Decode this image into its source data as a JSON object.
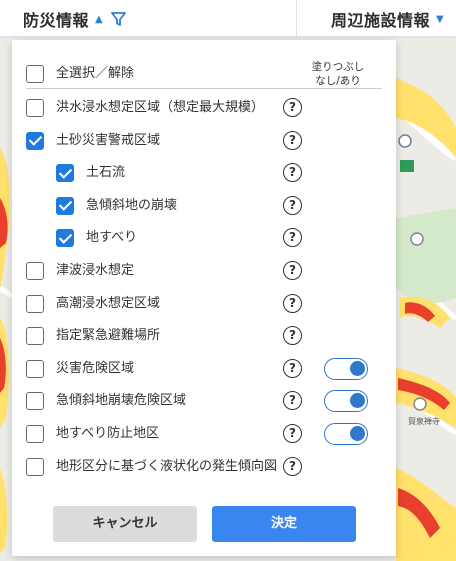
{
  "header": {
    "left_title": "防災情報",
    "right_title": "周辺施設情報",
    "accent": "#2f7fd9"
  },
  "panel": {
    "column_header": [
      "塗りつぶし",
      "なし/あり"
    ],
    "select_all": {
      "label": "全選択／解除",
      "checked": false
    },
    "items": [
      {
        "label": "洪水浸水想定区域（想定最大規模）",
        "checked": false,
        "indent": false,
        "toggle": false
      },
      {
        "label": "土砂災害警戒区域",
        "checked": true,
        "indent": false,
        "toggle": false
      },
      {
        "label": "土石流",
        "checked": true,
        "indent": true,
        "toggle": false
      },
      {
        "label": "急傾斜地の崩壊",
        "checked": true,
        "indent": true,
        "toggle": false
      },
      {
        "label": "地すべり",
        "checked": true,
        "indent": true,
        "toggle": false
      },
      {
        "label": "津波浸水想定",
        "checked": false,
        "indent": false,
        "toggle": false
      },
      {
        "label": "高潮浸水想定区域",
        "checked": false,
        "indent": false,
        "toggle": false
      },
      {
        "label": "指定緊急避難場所",
        "checked": false,
        "indent": false,
        "toggle": false
      },
      {
        "label": "災害危険区域",
        "checked": false,
        "indent": false,
        "toggle": true
      },
      {
        "label": "急傾斜地崩壊危険区域",
        "checked": false,
        "indent": false,
        "toggle": true
      },
      {
        "label": "地すべり防止地区",
        "checked": false,
        "indent": false,
        "toggle": true
      },
      {
        "label": "地形区分に基づく液状化の発生傾向図",
        "checked": false,
        "indent": false,
        "toggle": false
      }
    ],
    "help_glyph": "?",
    "cancel_label": "キャンセル",
    "ok_label": "決定"
  },
  "map": {
    "labels": [
      "賀泉禅寺"
    ]
  }
}
